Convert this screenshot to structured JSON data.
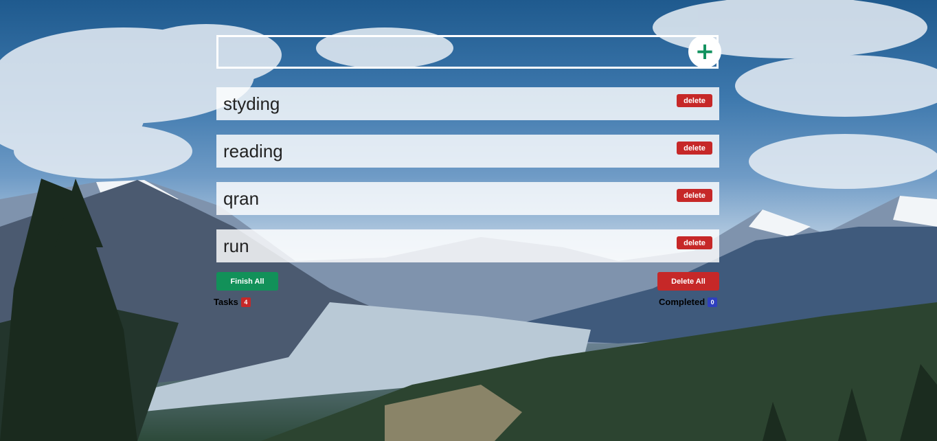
{
  "new_task": {
    "value": "",
    "placeholder": ""
  },
  "add_button": {
    "icon": "plus-icon",
    "glyph": "+",
    "color": "#12925f"
  },
  "tasks": [
    {
      "text": "styding",
      "delete_label": "delete"
    },
    {
      "text": "reading",
      "delete_label": "delete"
    },
    {
      "text": "qran",
      "delete_label": "delete"
    },
    {
      "text": "run",
      "delete_label": "delete"
    }
  ],
  "actions": {
    "finish_all_label": "Finish All",
    "delete_all_label": "Delete All"
  },
  "stats": {
    "tasks_label": "Tasks",
    "tasks_count": "4",
    "completed_label": "Completed",
    "completed_count": "0"
  },
  "colors": {
    "accent_green": "#129159",
    "danger_red": "#c62828",
    "completed_blue": "#2f3fbf"
  }
}
